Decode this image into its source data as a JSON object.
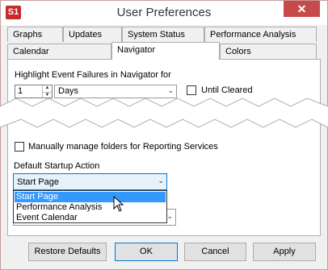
{
  "window": {
    "title": "User Preferences",
    "app_icon_text": "S1",
    "close_symbol": "✕"
  },
  "tabs": {
    "row1": [
      "Graphs",
      "Updates",
      "System Status",
      "Performance Analysis"
    ],
    "row2": [
      "Calendar",
      "Navigator",
      "Colors"
    ],
    "active": "Navigator"
  },
  "navigator": {
    "highlight_label": "Highlight Event Failures in Navigator for",
    "count_value": "1",
    "unit_value": "Days",
    "until_cleared_label": "Until Cleared",
    "until_cleared_checked": false,
    "manual_folders_label": "Manually manage folders for Reporting Services",
    "manual_folders_checked": false,
    "default_startup_label": "Default Startup Action",
    "startup_value": "Start Page",
    "startup_options": [
      "Start Page",
      "Performance Analysis",
      "Event Calendar"
    ],
    "startup_selected_index": 0
  },
  "buttons": {
    "restore_defaults": "Restore Defaults",
    "ok": "OK",
    "cancel": "Cancel",
    "apply": "Apply"
  },
  "colors": {
    "accent": "#3399ff",
    "close": "#c74a4a",
    "app_icon": "#c42b2b"
  }
}
